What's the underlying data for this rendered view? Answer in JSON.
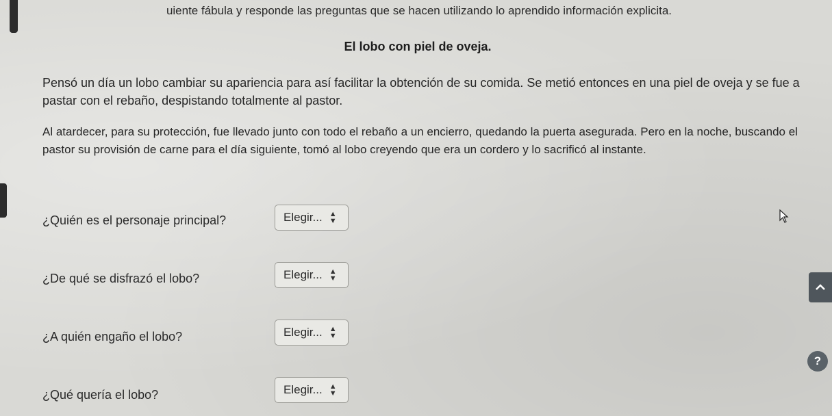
{
  "instruction": "uiente fábula y responde las preguntas que se hacen utilizando lo aprendido información explicita.",
  "story": {
    "title": "El lobo con piel de oveja.",
    "paragraphs": [
      "Pensó un día un lobo cambiar su apariencia para así facilitar la obtención de su comida. Se metió entonces en una piel de oveja y se fue a pastar con el rebaño, despistando totalmente al pastor.",
      "Al atardecer, para su protección, fue llevado junto con todo el rebaño a un encierro, quedando la puerta asegurada. Pero en la noche, buscando el pastor su provisión de carne para el día siguiente, tomó al lobo creyendo que era un cordero y lo sacrificó al instante."
    ]
  },
  "questions": [
    {
      "text": "¿Quién es el personaje principal?",
      "selected": "Elegir..."
    },
    {
      "text": "¿De qué se disfrazó el lobo?",
      "selected": "Elegir..."
    },
    {
      "text": "¿A quién engaño el lobo?",
      "selected": "Elegir..."
    },
    {
      "text": "¿Qué quería el lobo?",
      "selected": "Elegir..."
    }
  ],
  "help_label": "?",
  "icons": {
    "scroll_top": "chevron-up-icon",
    "help": "question-icon",
    "cursor": "mouse-pointer-icon",
    "select_arrows": "sort-arrows-icon"
  }
}
